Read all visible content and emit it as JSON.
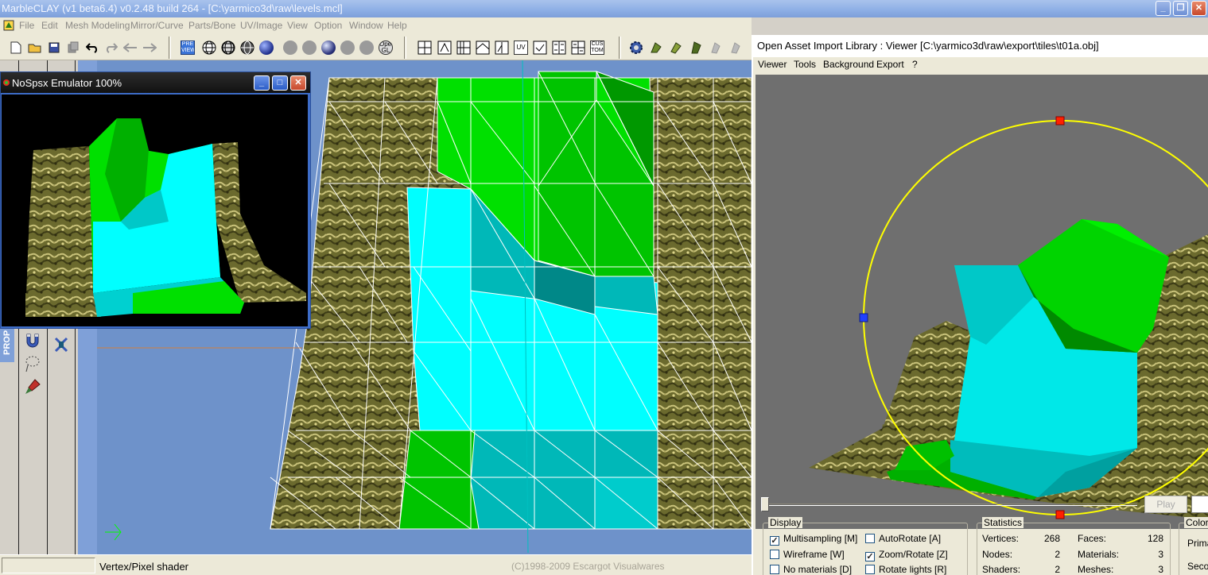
{
  "main_window": {
    "title": "MarbleCLAY (v1 beta6.4) v0.2.48 build 264 - [C:\\yarmico3d\\raw\\levels.mcl]",
    "controls": {
      "minimize": "_",
      "restore": "❐",
      "close": "✕"
    }
  },
  "menubar": {
    "items": [
      "File",
      "Edit",
      "Mesh Modeling",
      "Mirror/Curve",
      "Parts/Bone",
      "UV/Image",
      "View",
      "Option",
      "Window",
      "Help"
    ]
  },
  "toolbar": {
    "preview_label": "PRE VIEW",
    "opengl_label": "Open GL",
    "uv_label": "UV",
    "custom_label": "CUS TOM"
  },
  "left_panel": {
    "prop_tab": "PROP"
  },
  "emulator_window": {
    "title": "NoSpsx Emulator 100%",
    "controls": {
      "minimize": "_",
      "maximize": "□",
      "close": "✕"
    }
  },
  "statusbar": {
    "shader": "Vertex/Pixel shader",
    "copyright": "(C)1998-2009 Escargot Visualwares"
  },
  "assimp_viewer": {
    "title": "Open Asset Import Library : Viewer  [C:\\yarmico3d\\raw\\export\\tiles\\t01a.obj]",
    "menu": [
      "Viewer",
      "Tools",
      "Background",
      "Export",
      "?"
    ],
    "play_label": "Play",
    "display": {
      "label": "Display",
      "multisampling": {
        "label": "Multisampling [M]",
        "checked": true
      },
      "wireframe": {
        "label": "Wireframe [W]",
        "checked": false
      },
      "no_materials": {
        "label": "No materials [D]",
        "checked": false
      },
      "autorotate": {
        "label": "AutoRotate [A]",
        "checked": false
      },
      "zoom_rotate": {
        "label": "Zoom/Rotate [Z]",
        "checked": true
      },
      "rotate_lights": {
        "label": "Rotate lights [R]",
        "checked": false
      }
    },
    "statistics": {
      "label": "Statistics",
      "vertices_label": "Vertices:",
      "vertices": "268",
      "faces_label": "Faces:",
      "faces": "128",
      "nodes_label": "Nodes:",
      "nodes": "2",
      "materials_label": "Materials:",
      "materials": "3",
      "shaders_label": "Shaders:",
      "shaders": "2",
      "meshes_label": "Meshes:",
      "meshes": "3"
    },
    "colors": {
      "label": "Colors",
      "primary": "Prima",
      "secondary": "Seco"
    }
  },
  "palette": {
    "ground": "#6b6a2e",
    "cyan": "#00ffff",
    "cyan_shade": "#00b8b8",
    "green": "#00e000",
    "dark_green": "#00a800",
    "viewport_bg": "#6e92ca",
    "gizmo_ring": "#ffff00"
  }
}
